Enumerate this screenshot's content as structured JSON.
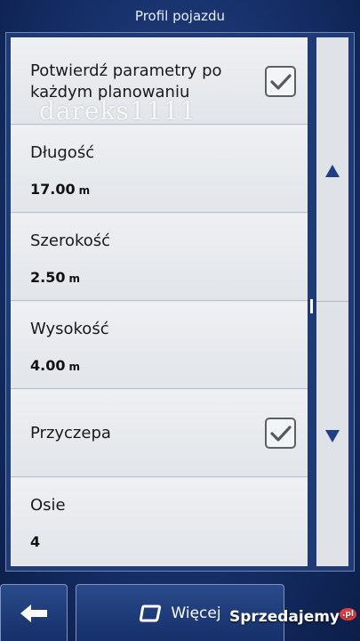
{
  "header": {
    "title": "Profil pojazdu"
  },
  "settings": [
    {
      "label": "Potwierdź parametry po każdym planowaniu",
      "checked": true
    },
    {
      "label": "Długość",
      "value": "17.00",
      "unit": "m"
    },
    {
      "label": "Szerokość",
      "value": "2.50",
      "unit": "m"
    },
    {
      "label": "Wysokość",
      "value": "4.00",
      "unit": "m"
    },
    {
      "label": "Przyczepa",
      "checked": true
    },
    {
      "label": "Osie",
      "value": "4"
    }
  ],
  "watermark": {
    "text": "dareks1111"
  },
  "scroll": {
    "up_icon": "triangle-up-icon",
    "down_icon": "triangle-down-icon"
  },
  "footer": {
    "back_icon": "arrow-left-icon",
    "more_icon": "rounded-square-icon",
    "more_label": "Więcej"
  },
  "badge": {
    "text": "Sprzedajemy",
    "suffix": ".pl"
  },
  "colors": {
    "background": "#16306a",
    "list_bg": "#e6e9ed",
    "arrow": "#1e3f86"
  }
}
